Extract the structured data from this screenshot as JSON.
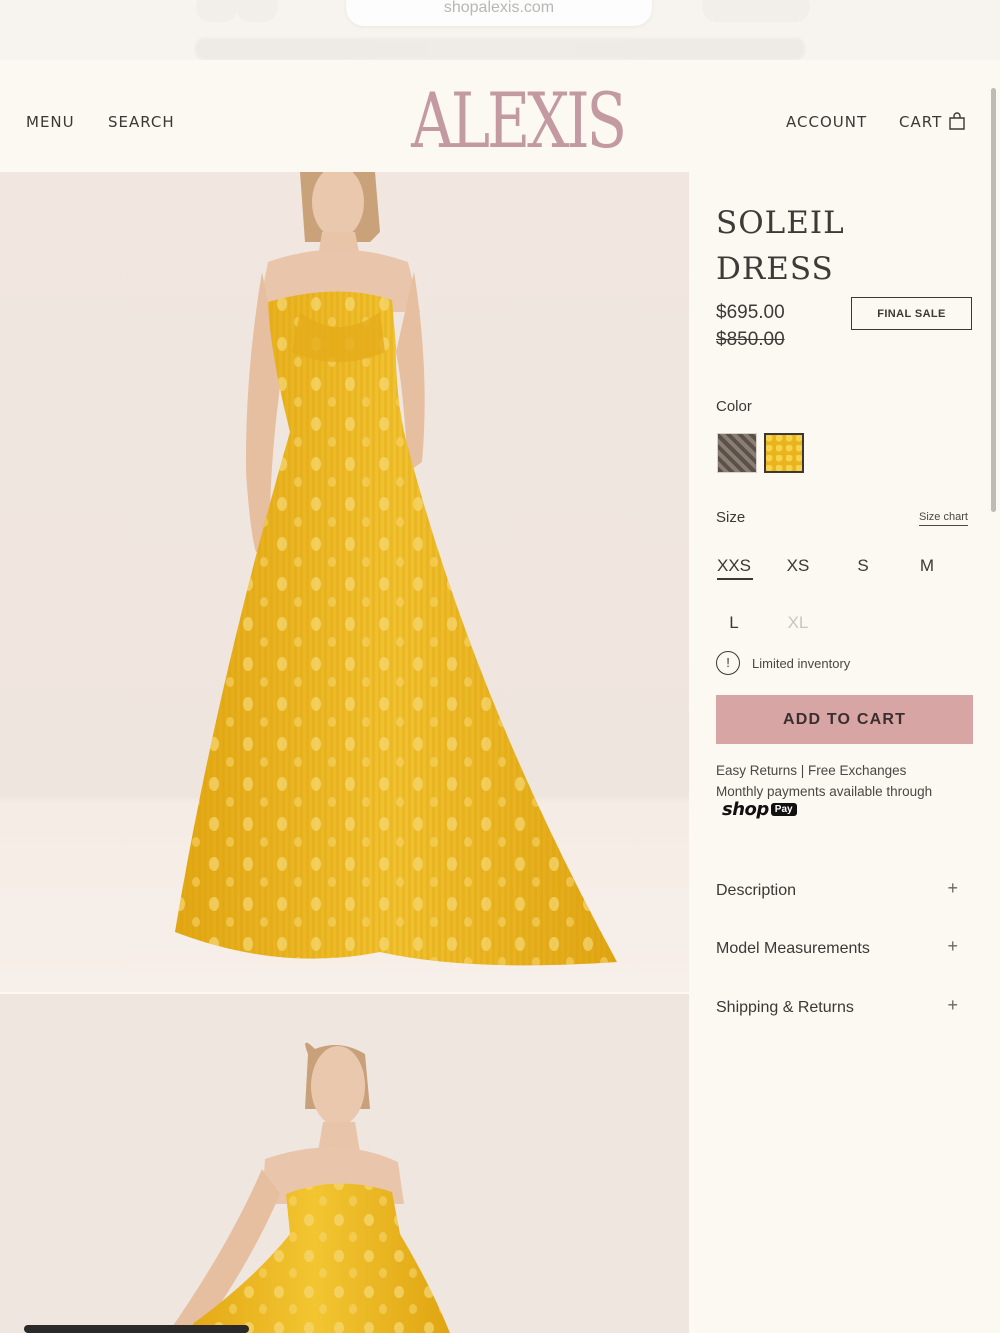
{
  "browser": {
    "url": "shopalexis.com"
  },
  "header": {
    "menu_label": "MENU",
    "search_label": "SEARCH",
    "logo_text": "ALEXIS",
    "account_label": "ACCOUNT",
    "cart_label": "CART",
    "cart_icon": "shopping-bag-icon"
  },
  "product": {
    "title": "SOLEIL DRESS",
    "price": "$695.00",
    "compare_price": "$850.00",
    "badge": "FINAL SALE",
    "color_label": "Color",
    "colors": [
      {
        "name": "black-pattern",
        "hex": "#6f655d"
      },
      {
        "name": "yellow",
        "hex": "#e9b41d",
        "selected": true
      }
    ],
    "size_label": "Size",
    "size_chart_label": "Size chart",
    "sizes": [
      {
        "label": "XXS",
        "selected": true,
        "available": true
      },
      {
        "label": "XS",
        "available": true
      },
      {
        "label": "S",
        "available": true
      },
      {
        "label": "M",
        "available": true
      },
      {
        "label": "L",
        "available": true
      },
      {
        "label": "XL",
        "available": false
      }
    ],
    "inventory_icon": "exclamation-circle-icon",
    "inventory_glyph": "!",
    "inventory_text": "Limited inventory",
    "add_to_cart_label": "ADD TO CART",
    "returns_text": "Easy Returns | Free Exchanges",
    "monthly_text": "Monthly payments available through",
    "shoppay_shop": "shop",
    "shoppay_pay": "Pay",
    "accordion": [
      {
        "label": "Description",
        "icon": "+"
      },
      {
        "label": "Model Measurements",
        "icon": "+"
      },
      {
        "label": "Shipping & Returns",
        "icon": "+"
      }
    ]
  },
  "colors": {
    "background": "#fcf8f2",
    "logo": "#c49aa2",
    "cta": "#d7a5a4",
    "dress": "#e9b41d"
  }
}
